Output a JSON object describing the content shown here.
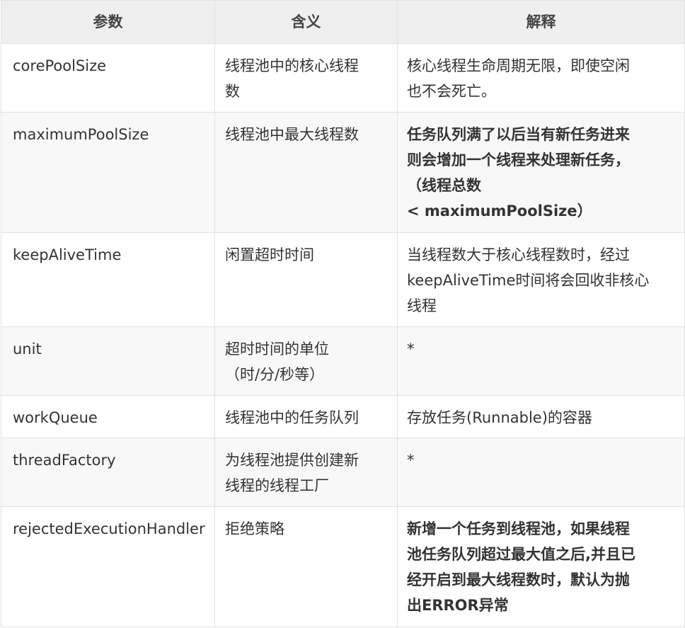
{
  "table": {
    "headers": [
      "参数",
      "含义",
      "解释"
    ],
    "rows": [
      {
        "param": "corePoolSize",
        "meaning": [
          "线程池中的核心线程",
          "数"
        ],
        "explain": [
          "核心线程生命周期无限，即使空闲",
          "也不会死亡。"
        ],
        "explain_bold": false
      },
      {
        "param": "maximumPoolSize",
        "meaning": [
          "线程池中最大线程数"
        ],
        "explain": [
          "任务队列满了以后当有新任务进来",
          "则会增加一个线程来处理新任务，",
          "（线程总数",
          "< maximumPoolSize）"
        ],
        "explain_bold": true
      },
      {
        "param": "keepAliveTime",
        "meaning": [
          "闲置超时时间"
        ],
        "explain": [
          "当线程数大于核心线程数时，经过",
          "keepAliveTime时间将会回收非核心",
          "线程"
        ],
        "explain_bold": false
      },
      {
        "param": "unit",
        "meaning": [
          "超时时间的单位",
          "（时/分/秒等）"
        ],
        "explain": [
          "*"
        ],
        "explain_bold": false
      },
      {
        "param": "workQueue",
        "meaning": [
          "线程池中的任务队列"
        ],
        "explain": [
          "存放任务(Runnable)的容器"
        ],
        "explain_bold": false
      },
      {
        "param": "threadFactory",
        "meaning": [
          "为线程池提供创建新",
          "线程的线程工厂"
        ],
        "explain": [
          "*"
        ],
        "explain_bold": false
      },
      {
        "param": "rejectedExecutionHandler",
        "meaning": [
          "拒绝策略"
        ],
        "explain": [
          "新增一个任务到线程池，如果线程",
          "池任务队列超过最大值之后,并且已",
          "经开启到最大线程数时，默认为抛",
          "出ERROR异常"
        ],
        "explain_bold": true
      }
    ]
  }
}
